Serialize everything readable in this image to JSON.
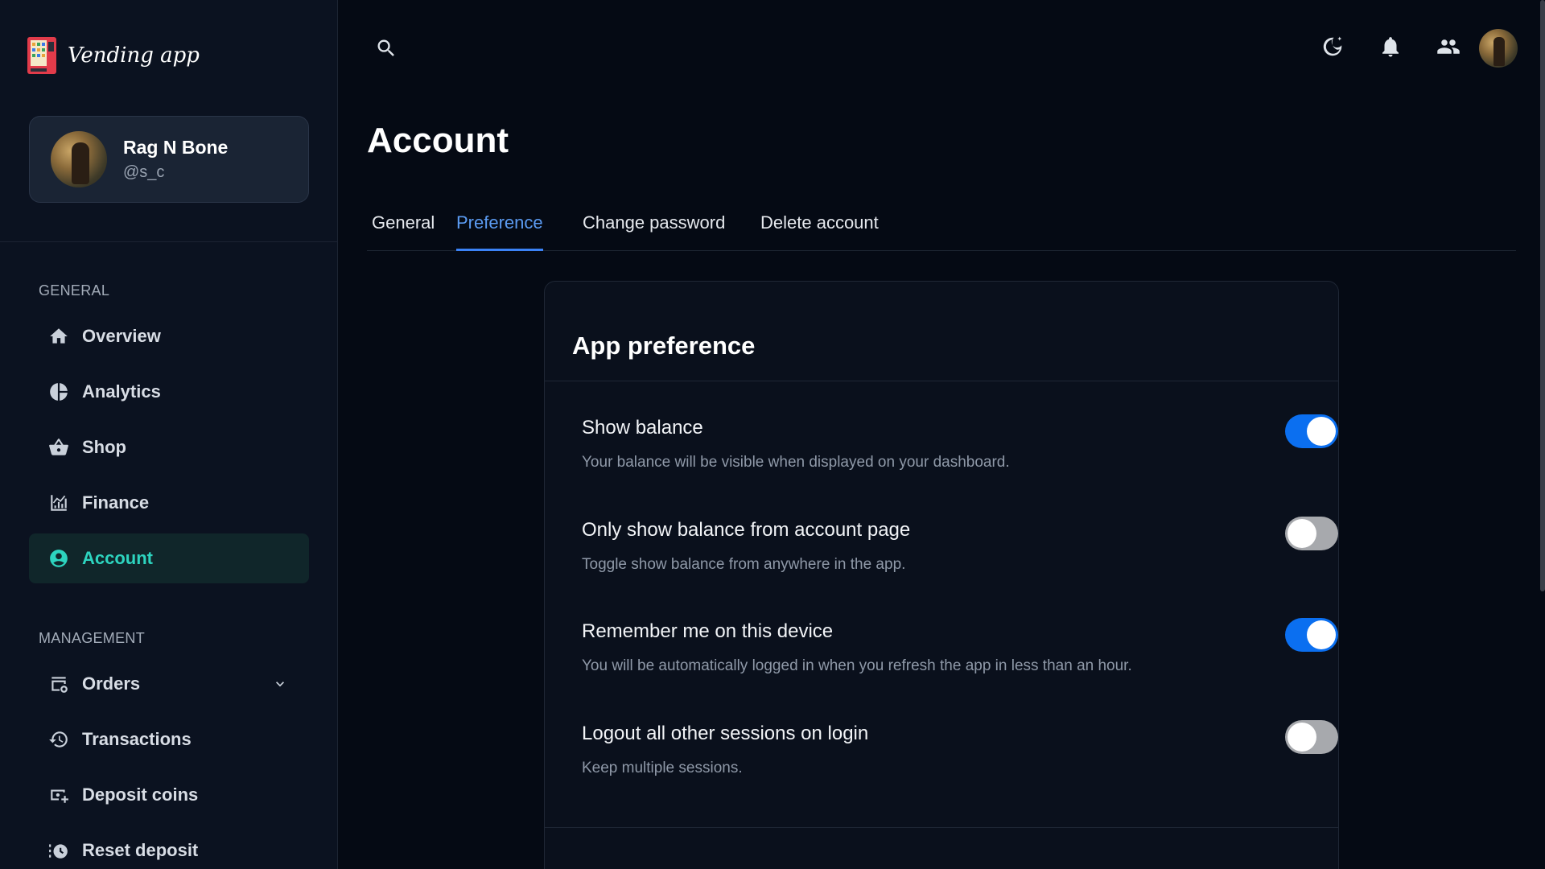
{
  "app": {
    "name": "Vending app"
  },
  "profile": {
    "name": "Rag N Bone",
    "handle": "@s_c"
  },
  "sidebar": {
    "general_label": "GENERAL",
    "management_label": "MANAGEMENT",
    "general_items": [
      {
        "label": "Overview",
        "icon": "home-icon"
      },
      {
        "label": "Analytics",
        "icon": "pie-chart-icon"
      },
      {
        "label": "Shop",
        "icon": "basket-icon"
      },
      {
        "label": "Finance",
        "icon": "finance-chart-icon"
      },
      {
        "label": "Account",
        "icon": "account-circle-icon",
        "active": true
      }
    ],
    "management_items": [
      {
        "label": "Orders",
        "icon": "orders-icon",
        "expandable": true
      },
      {
        "label": "Transactions",
        "icon": "history-icon"
      },
      {
        "label": "Deposit coins",
        "icon": "deposit-icon"
      },
      {
        "label": "Reset deposit",
        "icon": "reset-icon"
      }
    ]
  },
  "topbar": {
    "icons": [
      "search-icon",
      "dark-mode-icon",
      "notifications-icon",
      "people-icon",
      "user-avatar"
    ]
  },
  "page": {
    "title": "Account",
    "tabs": [
      {
        "label": "General",
        "active": false
      },
      {
        "label": "Preference",
        "active": true
      },
      {
        "label": "Change password",
        "active": false
      },
      {
        "label": "Delete account",
        "active": false
      }
    ]
  },
  "preferences": {
    "title": "App preference",
    "items": [
      {
        "title": "Show balance",
        "description": "Your balance will be visible when displayed on your dashboard.",
        "enabled": true
      },
      {
        "title": "Only show balance from account page",
        "description": "Toggle show balance from anywhere in the app.",
        "enabled": false
      },
      {
        "title": "Remember me on this device",
        "description": "You will be automatically logged in when you refresh the app in less than an hour.",
        "enabled": true
      },
      {
        "title": "Logout all other sessions on login",
        "description": "Keep multiple sessions.",
        "enabled": false
      }
    ]
  },
  "colors": {
    "accent_blue": "#3b82f6",
    "toggle_on": "#0b6ff0",
    "active_nav": "#2dd4bf",
    "background": "#050a14",
    "sidebar": "#0b1220"
  }
}
